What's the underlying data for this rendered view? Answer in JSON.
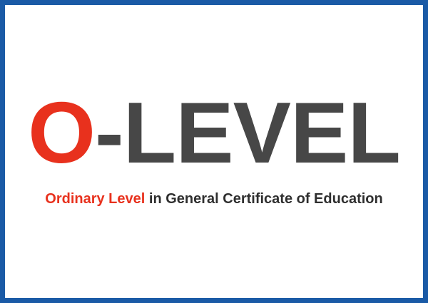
{
  "title": {
    "first_letter": "O",
    "rest": "-LEVEL"
  },
  "subtitle": {
    "highlight": "Ordinary Level",
    "rest": " in General Certificate of Education"
  },
  "colors": {
    "frame": "#1a5aa6",
    "accent": "#e8311d",
    "title_gray": "#474747",
    "text_dark": "#2f2f2f"
  }
}
